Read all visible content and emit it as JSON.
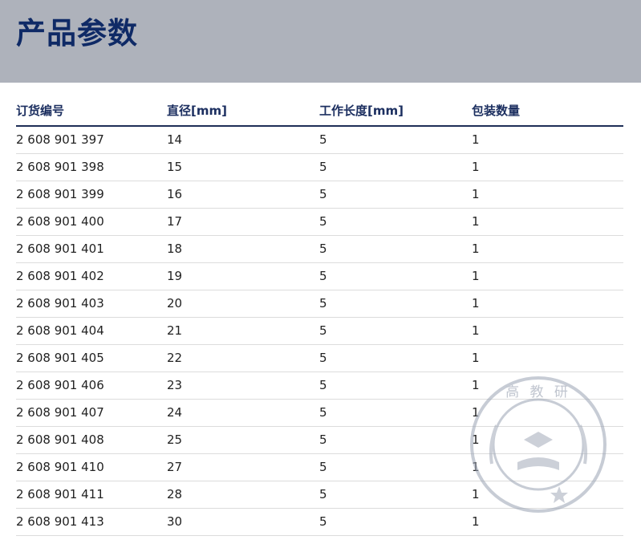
{
  "title": "产品参数",
  "columns": [
    "订货编号",
    "直径[mm]",
    "工作长度[mm]",
    "包装数量"
  ],
  "rows": [
    [
      "2 608 901 397",
      "14",
      "5",
      "1"
    ],
    [
      "2 608 901 398",
      "15",
      "5",
      "1"
    ],
    [
      "2 608 901 399",
      "16",
      "5",
      "1"
    ],
    [
      "2 608 901 400",
      "17",
      "5",
      "1"
    ],
    [
      "2 608 901 401",
      "18",
      "5",
      "1"
    ],
    [
      "2 608 901 402",
      "19",
      "5",
      "1"
    ],
    [
      "2 608 901 403",
      "20",
      "5",
      "1"
    ],
    [
      "2 608 901 404",
      "21",
      "5",
      "1"
    ],
    [
      "2 608 901 405",
      "22",
      "5",
      "1"
    ],
    [
      "2 608 901 406",
      "23",
      "5",
      "1"
    ],
    [
      "2 608 901 407",
      "24",
      "5",
      "1"
    ],
    [
      "2 608 901 408",
      "25",
      "5",
      "1"
    ],
    [
      "2 608 901 410",
      "27",
      "5",
      "1"
    ],
    [
      "2 608 901 411",
      "28",
      "5",
      "1"
    ],
    [
      "2 608 901 413",
      "30",
      "5",
      "1"
    ]
  ],
  "watermark": {
    "text": "高 教 研"
  },
  "colors": {
    "header_band": "#aeb2bb",
    "title": "#0f2a66",
    "column_header": "#1c2f60",
    "header_rule": "#1e2f57"
  }
}
